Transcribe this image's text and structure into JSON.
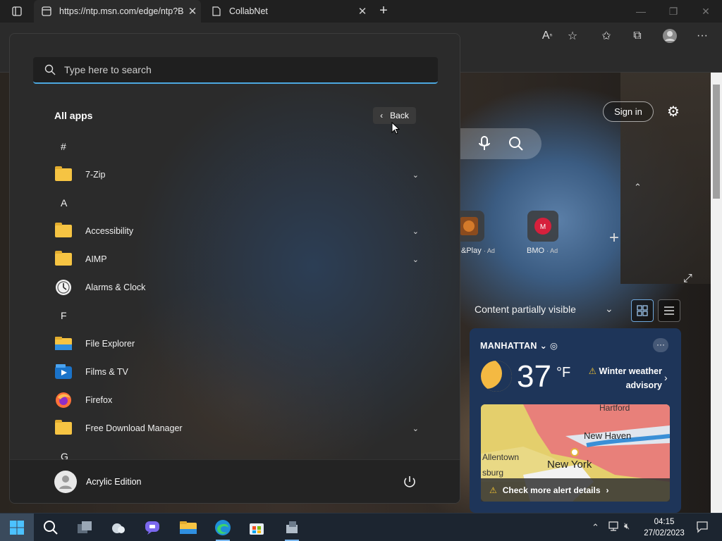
{
  "browser": {
    "tabs": [
      {
        "title": "https://ntp.msn.com/edge/ntp?B"
      },
      {
        "title": "CollabNet"
      }
    ],
    "new_tab_symbol": "+",
    "window_controls": {
      "minimize": "—",
      "restore": "❐",
      "close": "✕"
    }
  },
  "ntp": {
    "sign_in_label": "Sign in",
    "tiles": [
      {
        "label": "&Play",
        "ad": "· Ad"
      },
      {
        "label": "BMO",
        "ad": "· Ad"
      }
    ],
    "content_visibility": "Content partially visible",
    "weather": {
      "location": "MANHATTAN",
      "temperature": "37",
      "unit": "°F",
      "alert": "Winter weather advisory",
      "map_labels": [
        "Hartford",
        "New Haven",
        "Allentown",
        "sburg",
        "New York"
      ],
      "footer": "Check more alert details"
    }
  },
  "start_menu": {
    "search_placeholder": "Type here to search",
    "title": "All apps",
    "back_label": "Back",
    "letters": [
      "#",
      "A",
      "F",
      "G"
    ],
    "apps": [
      {
        "label": "7-Zip",
        "icon": "folder-icon",
        "expandable": true
      },
      {
        "label": "Accessibility",
        "icon": "folder-icon",
        "expandable": true
      },
      {
        "label": "AIMP",
        "icon": "folder-icon",
        "expandable": true
      },
      {
        "label": "Alarms & Clock",
        "icon": "clock-icon",
        "expandable": false
      },
      {
        "label": "File Explorer",
        "icon": "file-explorer-icon",
        "expandable": false
      },
      {
        "label": "Films & TV",
        "icon": "films-tv-icon",
        "expandable": false
      },
      {
        "label": "Firefox",
        "icon": "firefox-icon",
        "expandable": false
      },
      {
        "label": "Free Download Manager",
        "icon": "folder-icon",
        "expandable": true
      }
    ],
    "user_name": "Acrylic Edition"
  },
  "taskbar": {
    "time": "04:15",
    "date": "27/02/2023"
  },
  "colors": {
    "accent": "#4ca8e0",
    "folder": "#f6c443",
    "weather_card": "#1e3559"
  }
}
